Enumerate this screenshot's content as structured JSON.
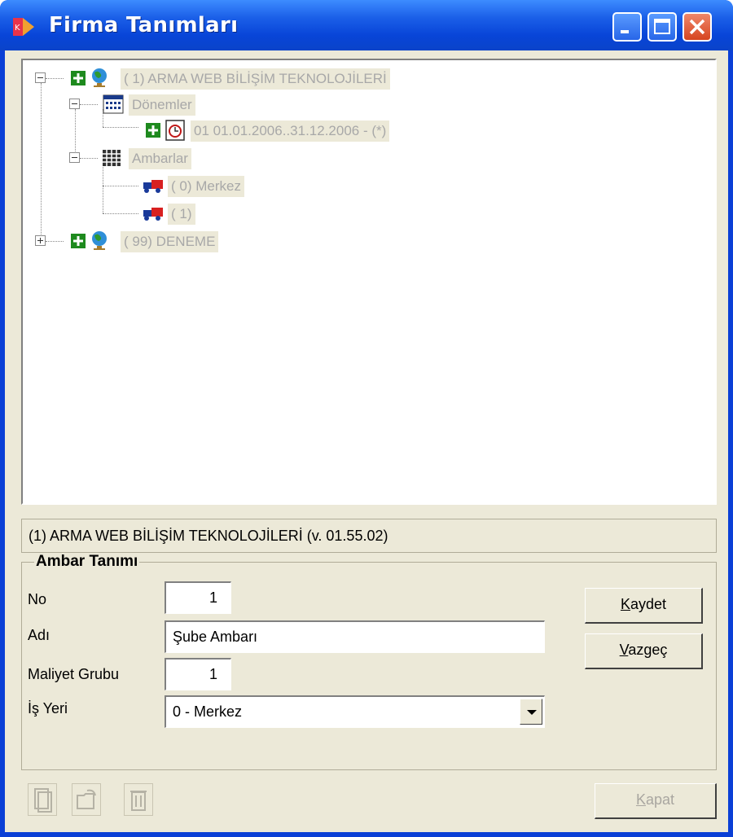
{
  "window": {
    "title": "Firma Tanımları"
  },
  "tree": {
    "nodes": [
      {
        "label": "( 1) ARMA WEB BİLİŞİM TEKNOLOJİLERİ",
        "icon": "globe-icon"
      },
      {
        "label": "Dönemler",
        "icon": "calendar-icon"
      },
      {
        "label": "01 01.01.2006..31.12.2006 - (*)",
        "icon": "clock-icon"
      },
      {
        "label": "Ambarlar",
        "icon": "warehouse-icon"
      },
      {
        "label": "(   0) Merkez",
        "icon": "truck-icon"
      },
      {
        "label": "(   1)",
        "icon": "truck-icon"
      },
      {
        "label": "( 99) DENEME",
        "icon": "globe-icon"
      }
    ]
  },
  "status": {
    "text": "(1) ARMA WEB BİLİŞİM TEKNOLOJİLERİ  (v. 01.55.02)"
  },
  "form": {
    "group_title": "Ambar Tanımı",
    "no_label": "No",
    "no_value": "1",
    "adi_label": "Adı",
    "adi_value": "Şube Ambarı",
    "maliyet_label": "Maliyet Grubu",
    "maliyet_value": "1",
    "isyeri_label": "İş Yeri",
    "isyeri_value": "0 - Merkez"
  },
  "buttons": {
    "kaydet_first": "K",
    "kaydet_rest": "aydet",
    "vazgec_first": "V",
    "vazgec_rest": "azgeç",
    "kapat_first": "K",
    "kapat_rest": "apat"
  },
  "toolbar": {
    "icons": [
      "new-document-icon",
      "open-folder-icon",
      "delete-icon"
    ]
  }
}
